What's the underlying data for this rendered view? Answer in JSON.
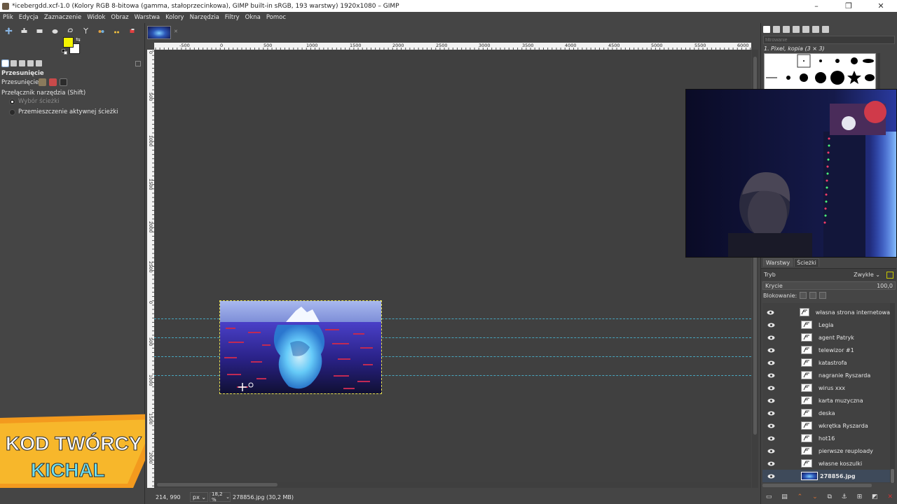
{
  "window": {
    "title": "*icebergdd.xcf-1.0 (Kolory RGB 8-bitowa (gamma, stałoprzecinkowa), GIMP built-in sRGB, 193 warstwy) 1920x1080 – GIMP"
  },
  "menu": [
    "Plik",
    "Edycja",
    "Zaznaczenie",
    "Widok",
    "Obraz",
    "Warstwa",
    "Kolory",
    "Narzędzia",
    "Filtry",
    "Okna",
    "Pomoc"
  ],
  "colors": {
    "foreground": "#f5f500",
    "background": "#ffffff",
    "guide": "#4ab8d6",
    "selected_layer": "#3e4a5a"
  },
  "tool_options": {
    "title": "Przesunięcie",
    "move_label": "Przesunięcie:",
    "switch_label": "Przełącznik narzędzia  (Shift)",
    "options": [
      {
        "label": "Wybór ścieżki",
        "selected": true
      },
      {
        "label": "Przemieszczenie aktywnej ścieżki",
        "selected": false
      }
    ]
  },
  "rulers": {
    "horizontal": [
      "-500",
      "0",
      "500",
      "1000",
      "1500",
      "2000",
      "2500",
      "3000",
      "3500",
      "4000",
      "4500",
      "5000",
      "5500",
      "6000"
    ],
    "vertical": [
      "0",
      "500",
      "1000",
      "1500",
      "2000",
      "2500",
      "0",
      "500",
      "1000",
      "1500",
      "2000"
    ]
  },
  "status": {
    "coords": "214, 990",
    "unit": "px",
    "zoom": "18,2 %",
    "file": "278856.jpg (30,2 MB)"
  },
  "brushes": {
    "filter_placeholder": "filtrowanie",
    "current": "1. Pixel, kopia (3 × 3)"
  },
  "layers_panel": {
    "tabs": [
      "Warstwy",
      "Ścieżki"
    ],
    "mode_label": "Tryb",
    "mode_value": "Zwykłe",
    "opacity_label": "Krycie",
    "opacity_value": "100,0",
    "lock_label": "Blokowanie:",
    "layers": [
      {
        "name": "własna strona internetowa",
        "selected": false
      },
      {
        "name": "Legia",
        "selected": false
      },
      {
        "name": "agent Patryk",
        "selected": false
      },
      {
        "name": "telewizor #1",
        "selected": false
      },
      {
        "name": "katastrofa",
        "selected": false
      },
      {
        "name": "nagranie Ryszarda",
        "selected": false
      },
      {
        "name": "wirus xxx",
        "selected": false
      },
      {
        "name": "karta muzyczna",
        "selected": false
      },
      {
        "name": "deska",
        "selected": false
      },
      {
        "name": "wkrętka Ryszarda",
        "selected": false
      },
      {
        "name": "hot16",
        "selected": false
      },
      {
        "name": "pierwsze reuploady",
        "selected": false
      },
      {
        "name": "własne koszulki",
        "selected": false
      },
      {
        "name": "278856.jpg",
        "selected": true
      }
    ]
  },
  "overlay": {
    "line1": "KOD TWÓRCY",
    "line2": "KICHAL"
  }
}
